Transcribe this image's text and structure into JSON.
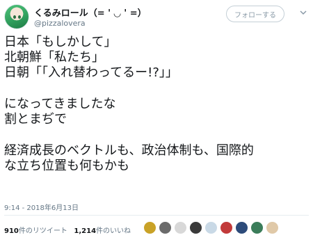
{
  "user": {
    "display_name": "くるみロール（= ' ◡ ' =）",
    "handle": "@pizzalovera",
    "follow_label": "フォローする"
  },
  "tweet": {
    "lines": [
      "日本「もしかして」",
      "北朝鮮「私たち」",
      "日朝「「入れ替わってるー!?」」",
      "",
      "になってきましたな",
      "割とまぢで",
      "",
      "経済成長のベクトルも、政治体制も、国際的",
      "な立ち位置も何もかも"
    ],
    "timestamp": "9:14 - 2018年6月13日"
  },
  "stats": {
    "retweet_count": "910",
    "retweet_label": "件のリツイート",
    "like_count": "1,214",
    "like_label": "件のいいね"
  },
  "likers": [
    {
      "name": "liker-1",
      "color": "#c9a227"
    },
    {
      "name": "liker-2",
      "color": "#6b6b6b"
    },
    {
      "name": "liker-3",
      "color": "#d8d8d8"
    },
    {
      "name": "liker-4",
      "color": "#3a3a3a"
    },
    {
      "name": "liker-5",
      "color": "#c9d9e6"
    },
    {
      "name": "liker-6",
      "color": "#c23a3a"
    },
    {
      "name": "liker-7",
      "color": "#2d4b7a"
    },
    {
      "name": "liker-8",
      "color": "#3b7d5a"
    },
    {
      "name": "liker-9",
      "color": "#e0c9a8"
    }
  ]
}
